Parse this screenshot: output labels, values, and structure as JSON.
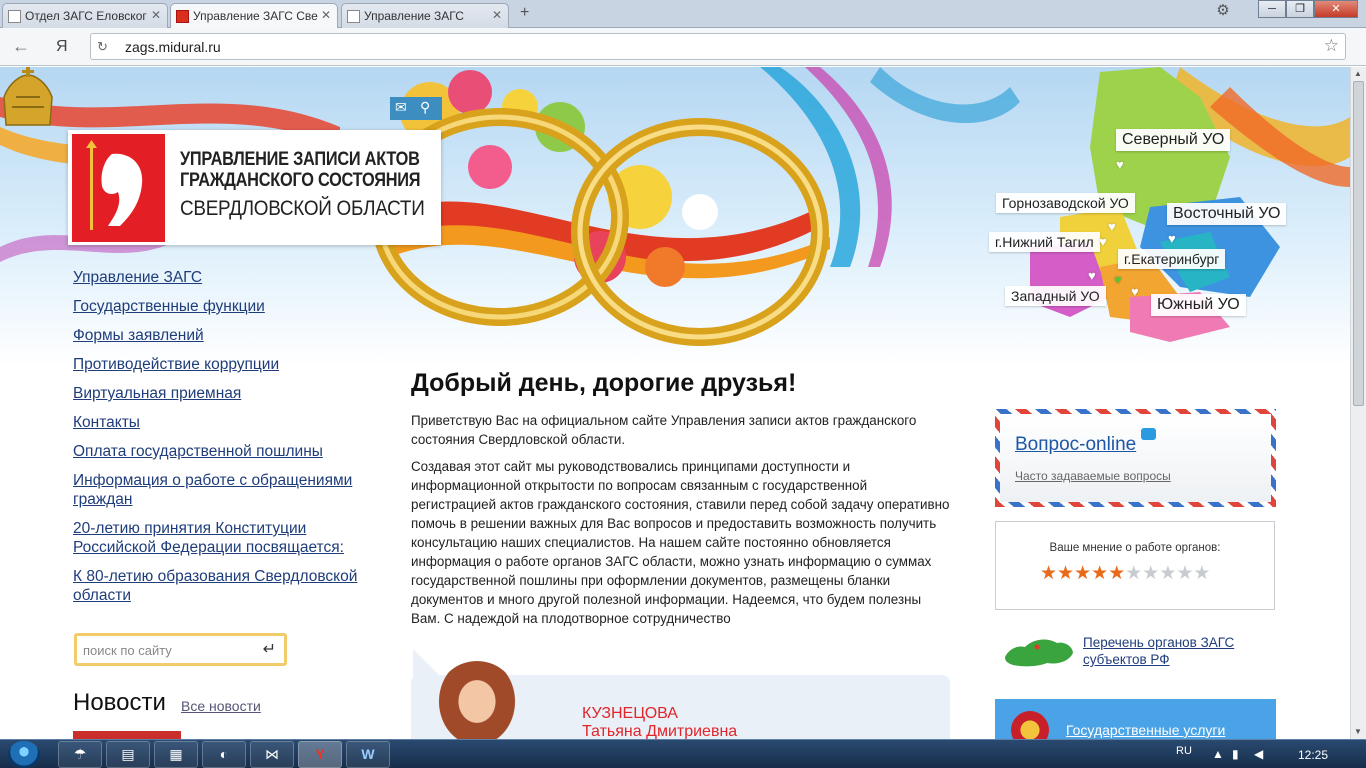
{
  "browser": {
    "tabs": [
      {
        "label": "Отдел ЗАГС Еловског"
      },
      {
        "label": "Управление ЗАГС Све"
      },
      {
        "label": "Управление ЗАГС"
      }
    ],
    "address": "zags.midural.ru",
    "yandex_label": "Я"
  },
  "header": {
    "logo_lines": [
      "УПРАВЛЕНИЕ ЗАПИСИ АКТОВ",
      "ГРАЖДАНСКОГО СОСТОЯНИЯ",
      "СВЕРДЛОВСКОЙ ОБЛАСТИ"
    ],
    "map_labels": {
      "north": "Северный УО",
      "gornozavodskoy": "Горнозаводской УО",
      "east": "Восточный УО",
      "nizhny_tagil": "г.Нижний Тагил",
      "ekaterinburg": "г.Екатеринбург",
      "west": "Западный УО",
      "south": "Южный УО"
    }
  },
  "nav": {
    "items": [
      "Управление ЗАГС",
      "Государственные функции",
      "Формы заявлений",
      "Противодействие коррупции",
      "Виртуальная приемная",
      "Контакты",
      "Оплата государственной пошлины",
      "Информация о работе с обращениями граждан",
      "20-летию принятия Конституции Российской Федерации посвящается:",
      "К 80-летию образования Свердловской области"
    ]
  },
  "search": {
    "placeholder": "поиск по сайту"
  },
  "news": {
    "title": "Новости",
    "all_link": "Все новости"
  },
  "main": {
    "greeting": "Добрый день, дорогие друзья!",
    "para1": "Приветствую Вас на официальном сайте Управления записи актов гражданского состояния Свердловской области.",
    "para2": "Создавая этот сайт мы руководствовались принципами доступности и информационной открытости по вопросам связанным с государственной регистрацией актов гражданского состояния, ставили перед собой задачу оперативно помочь в решении важных для Вас вопросов и предоставить возможность получить консультацию наших специалистов. На нашем сайте постоянно обновляется информация о работе органов ЗАГС области, можно узнать информацию о суммах государственной пошлины при оформлении документов, размещены бланки документов и много другой полезной информации. Надеемся, что будем полезны Вам. С надеждой на плодотворное сотрудничество",
    "person_surname": "КУЗНЕЦОВА",
    "person_name": "Татьяна Дмитриевна"
  },
  "sidebar": {
    "question_title": "Вопрос-online",
    "faq_link": "Часто задаваемые вопросы",
    "rating_label": "Ваше мнение о работе органов:",
    "rating_value": 5,
    "rating_max": 10,
    "registry_link": "Перечень органов ЗАГС субъектов РФ",
    "gov_services": "Государственные услуги"
  },
  "taskbar": {
    "lang": "RU",
    "time": "12:25"
  },
  "colors": {
    "link": "#1f3d7a",
    "accent_red": "#e0262a",
    "star_on": "#e96a19",
    "star_off": "#c8ccd0",
    "blue": "#4aa3e6"
  }
}
